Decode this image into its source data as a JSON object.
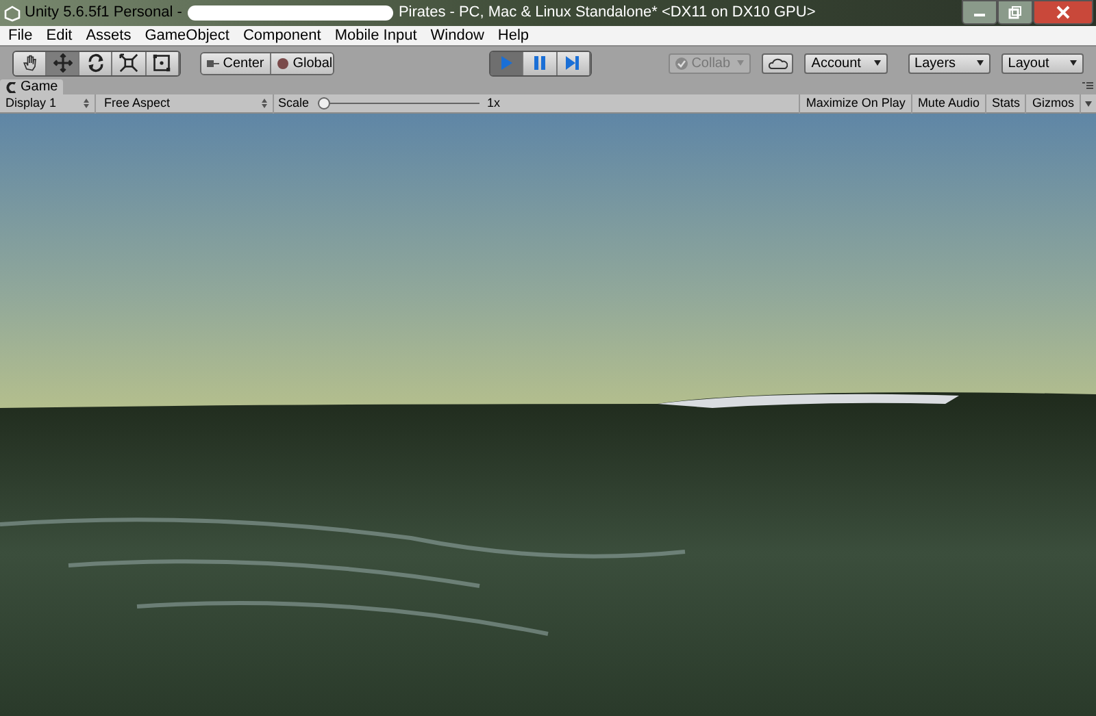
{
  "window": {
    "title_start": "Unity 5.6.5f1 Personal -",
    "title_end": "Pirates - PC, Mac & Linux Standalone* <DX11 on DX10 GPU>"
  },
  "menu": [
    "File",
    "Edit",
    "Assets",
    "GameObject",
    "Component",
    "Mobile Input",
    "Window",
    "Help"
  ],
  "tools": [
    {
      "kind": "hand",
      "selected": false
    },
    {
      "kind": "move",
      "selected": true
    },
    {
      "kind": "rotate",
      "selected": false
    },
    {
      "kind": "scale",
      "selected": false
    },
    {
      "kind": "rect",
      "selected": false
    }
  ],
  "pivot": [
    "Center",
    "Global"
  ],
  "playback": [
    {
      "kind": "play",
      "selected": true
    },
    {
      "kind": "pause",
      "selected": false
    },
    {
      "kind": "step",
      "selected": false
    }
  ],
  "collab": {
    "label": "Collab",
    "disabled": true
  },
  "account": "Account",
  "layers": "Layers",
  "layout": "Layout",
  "game_tab": "Game",
  "game_toolbar": {
    "display": "Display 1",
    "aspect": "Free Aspect",
    "scale_label": "Scale",
    "scale": {
      "level": 0
    },
    "scale_value": "1x",
    "toggles": [
      "Maximize On Play",
      "Mute Audio",
      "Stats",
      "Gizmos"
    ]
  }
}
